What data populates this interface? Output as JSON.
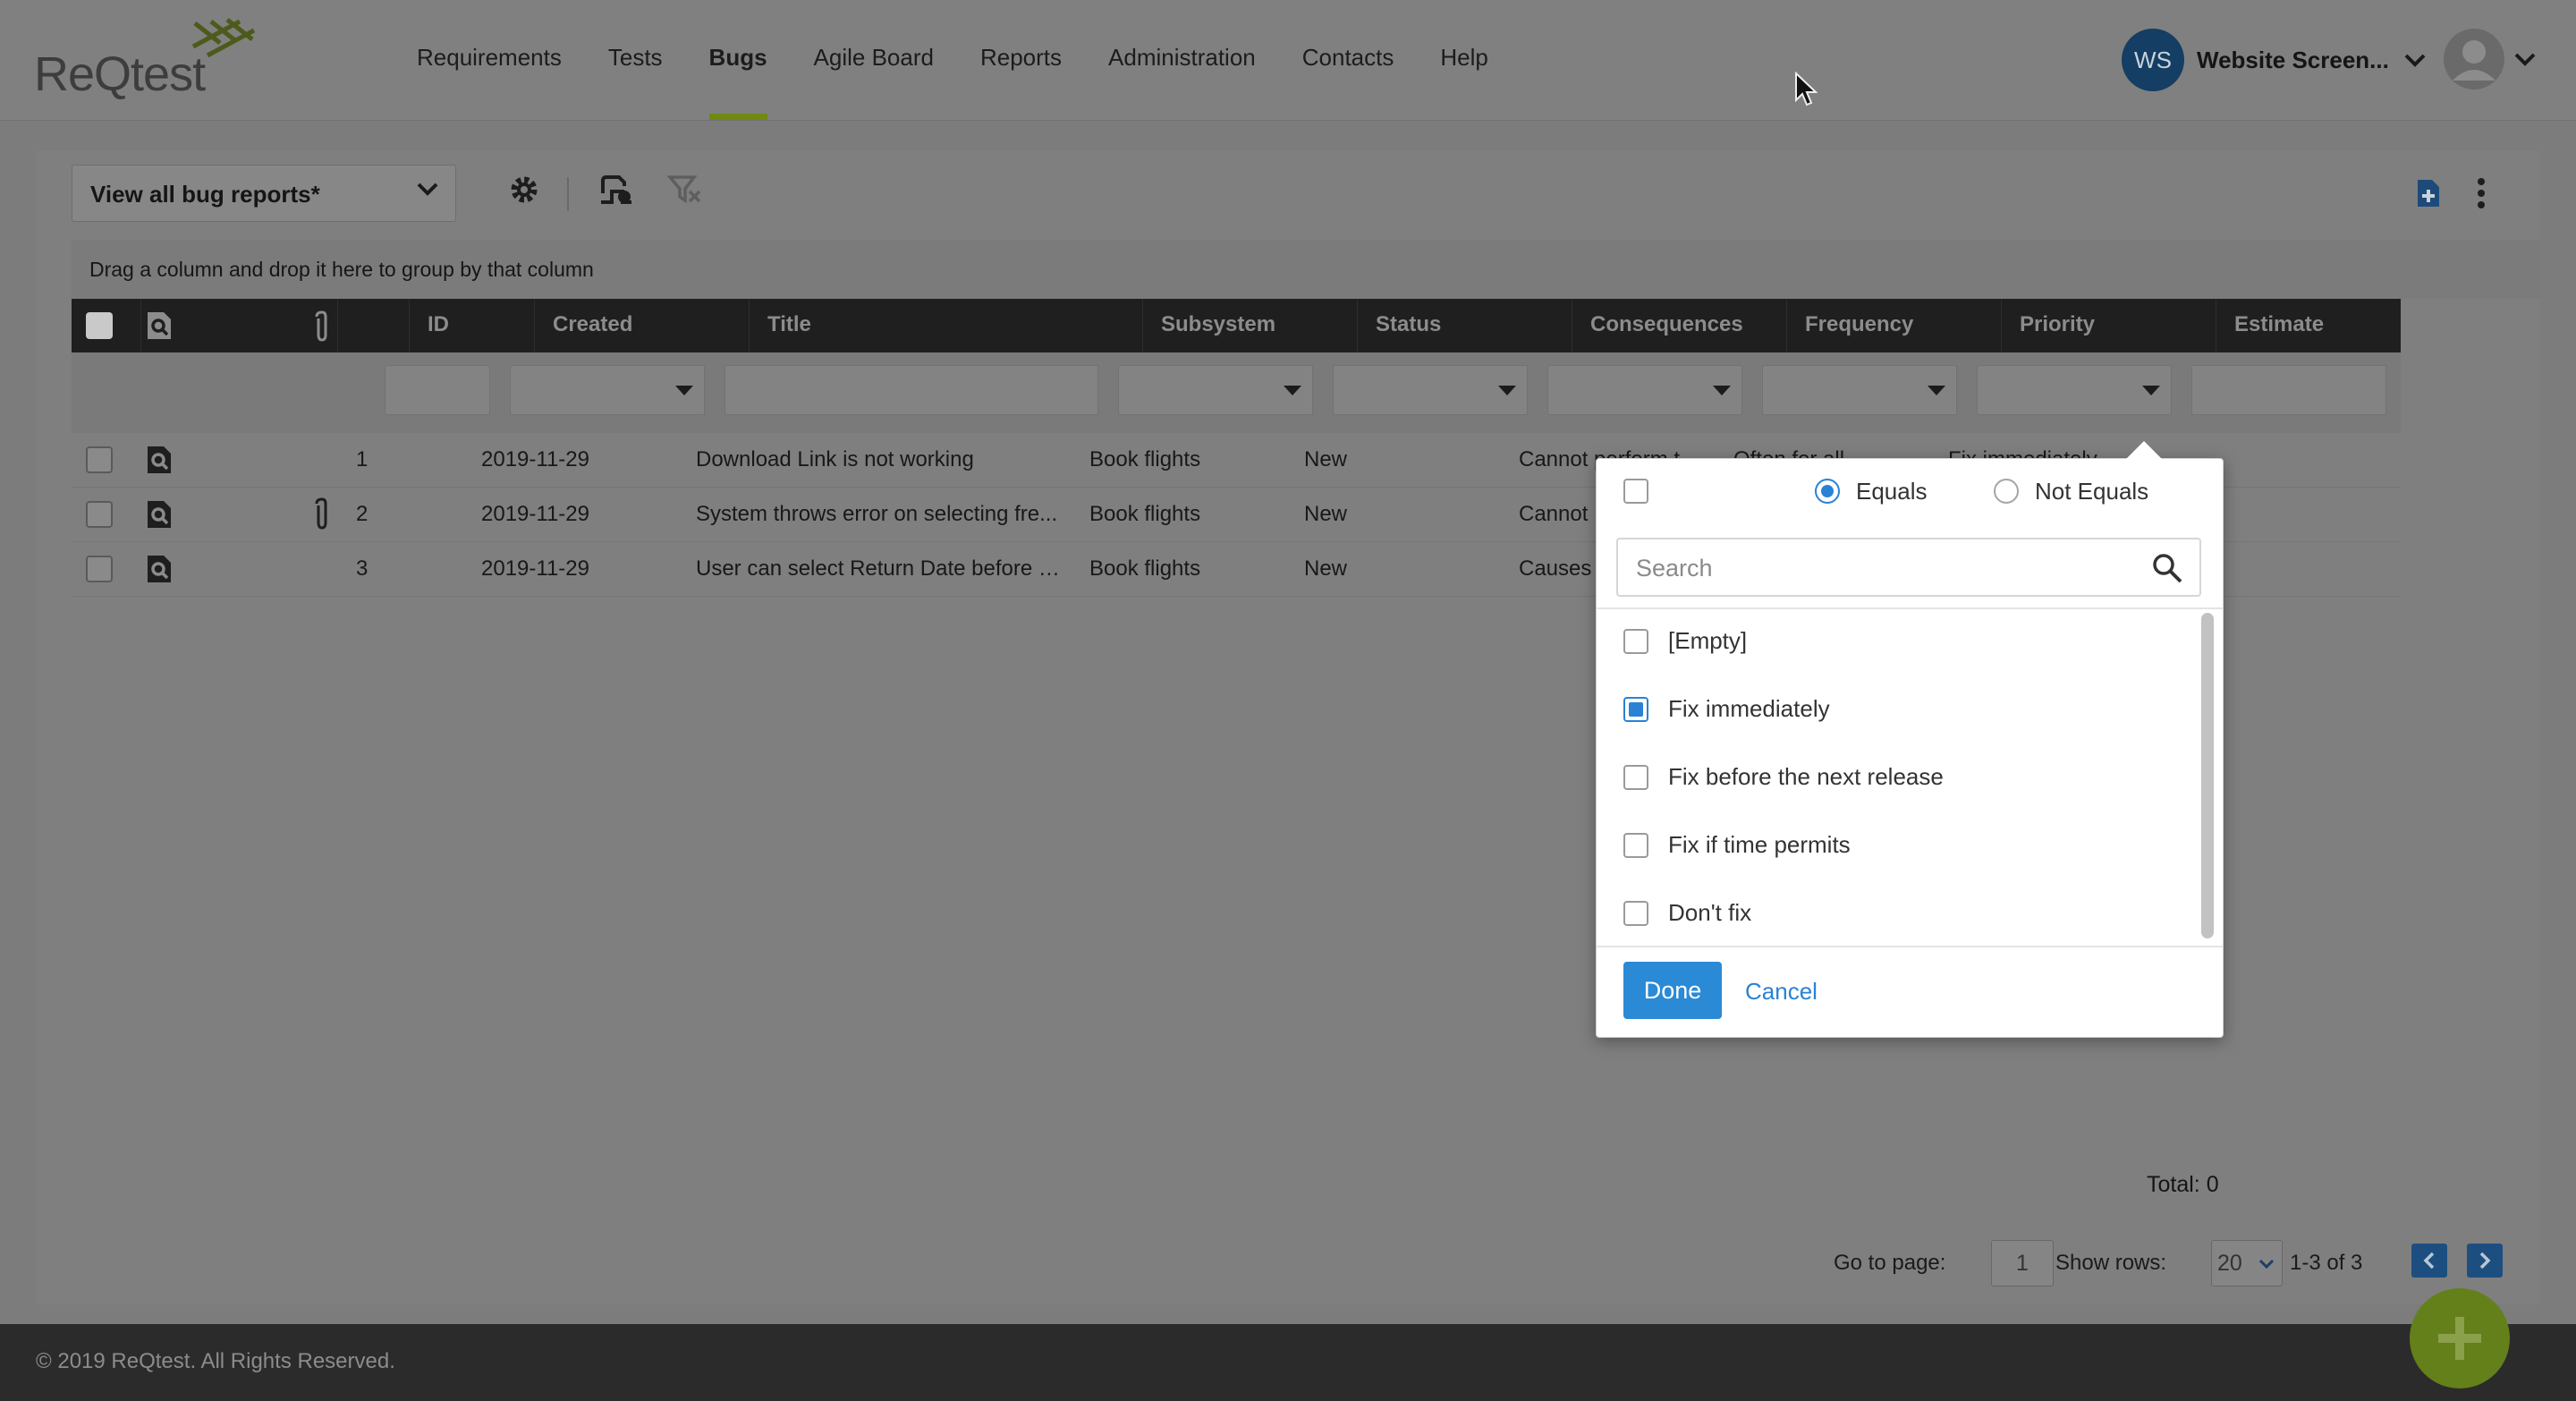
{
  "header": {
    "logo_text": "ReQtest",
    "nav": [
      "Requirements",
      "Tests",
      "Bugs",
      "Agile Board",
      "Reports",
      "Administration",
      "Contacts",
      "Help"
    ],
    "active_nav": "Bugs",
    "user_initials": "WS",
    "user_name": "Website Screen..."
  },
  "toolbar": {
    "view_label": "View all bug reports*",
    "group_hint": "Drag a column and drop it here to group by that column"
  },
  "grid": {
    "columns": [
      "ID",
      "Created",
      "Title",
      "Subsystem",
      "Status",
      "Consequences",
      "Frequency",
      "Priority",
      "Estimate"
    ],
    "rows": [
      {
        "id": "1",
        "created": "2019-11-29",
        "title": "Download Link is not working",
        "subsystem": "Book flights",
        "status": "New",
        "consequences": "Cannot perform t...",
        "frequency": "Often for all",
        "priority": "Fix immediately",
        "has_attachment": false
      },
      {
        "id": "2",
        "created": "2019-11-29",
        "title": "System throws error on selecting fre...",
        "subsystem": "Book flights",
        "status": "New",
        "consequences": "Cannot",
        "frequency": "",
        "priority": "",
        "has_attachment": true
      },
      {
        "id": "3",
        "created": "2019-11-29",
        "title": "User can select Return Date before D...",
        "subsystem": "Book flights",
        "status": "New",
        "consequences": "Causes",
        "frequency": "",
        "priority": "",
        "has_attachment": false
      }
    ]
  },
  "footer": {
    "total": "Total: 0",
    "goto_label": "Go to page:",
    "goto_value": "1",
    "rows_label": "Show rows:",
    "rows_value": "20",
    "range": "1-3 of 3"
  },
  "filter_popup": {
    "equals_label": "Equals",
    "not_equals_label": "Not Equals",
    "selected_mode": "Equals",
    "search_placeholder": "Search",
    "options": [
      {
        "label": "[Empty]",
        "checked": false
      },
      {
        "label": "Fix immediately",
        "checked": true
      },
      {
        "label": "Fix before the next release",
        "checked": false
      },
      {
        "label": "Fix if time permits",
        "checked": false
      },
      {
        "label": "Don't fix",
        "checked": false
      }
    ],
    "done_label": "Done",
    "cancel_label": "Cancel"
  },
  "copyright": "© 2019 ReQtest. All Rights Reserved.",
  "colors": {
    "accent_green": "#6f8a10",
    "primary_blue": "#2a8ad6",
    "header_dark": "#1f1f1f"
  }
}
